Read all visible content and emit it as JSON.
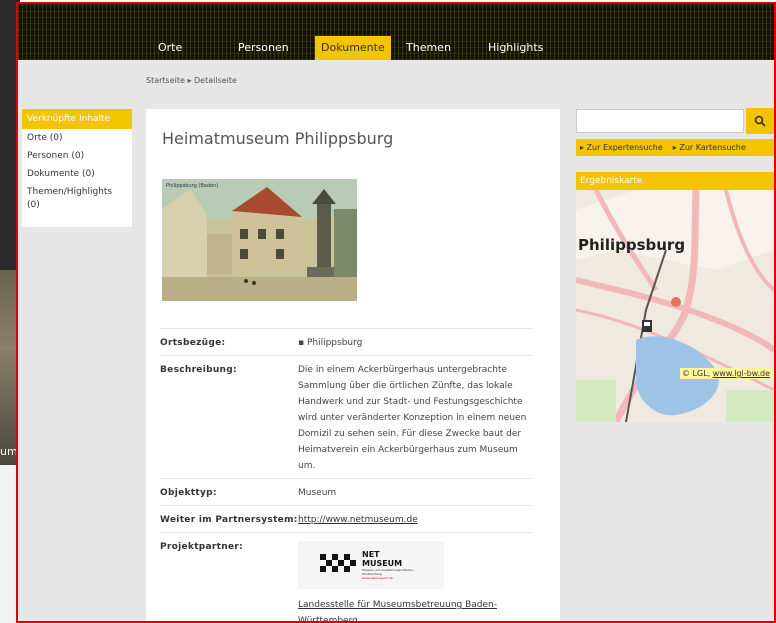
{
  "nav": {
    "items": [
      {
        "label": "Orte",
        "active": false
      },
      {
        "label": "Personen",
        "active": false
      },
      {
        "label": "Dokumente",
        "active": true
      },
      {
        "label": "Themen",
        "active": false
      },
      {
        "label": "Highlights",
        "active": false
      }
    ]
  },
  "breadcrumb": "Startseite ▸ Detailseite",
  "sidebar": {
    "title": "Verknüpfte Inhalte",
    "items": [
      "Orte (0)",
      "Personen (0)",
      "Dokumente (0)",
      "Themen/Highlights (0)"
    ]
  },
  "main": {
    "title": "Heimatmuseum Philippsburg",
    "photo_caption": "Philippsburg (Baden)",
    "details": [
      {
        "label": "Ortsbezüge:",
        "value": "▪ Philippsburg"
      },
      {
        "label": "Beschreibung:",
        "value": "Die in einem Ackerbürgerhaus untergebrachte Sammlung über die örtlichen Zünfte, das lokale Handwerk und zur Stadt- und Festungsgeschichte wird unter veränderter Konzeption in einem neuen Domizil zu sehen sein. Für diese Zwecke baut der Heimatverein ein Ackerbürgerhaus zum Museum um."
      },
      {
        "label": "Objekttyp:",
        "value": "Museum"
      },
      {
        "label": "Weiter im Partnersystem:",
        "value": "http://www.netmuseum.de"
      },
      {
        "label": "Projektpartner:",
        "value": "Landesstelle für Museumsbetreuung Baden-Württemberg"
      }
    ],
    "partner_logo": {
      "line1": "NET",
      "line2": "MUSEUM",
      "line3": "Museen und Ausstellungen Baden-Württemberg",
      "line4": "www.netmuseum.de"
    }
  },
  "right": {
    "search_placeholder": "",
    "search_icon": "search-icon",
    "links": [
      "▸ Zur Expertensuche",
      "▸ Zur Kartensuche"
    ],
    "map_title": "Ergebniskarte",
    "map_city": "Philippsburg",
    "map_copyright_prefix": "© LGL,",
    "map_copyright_link": "www.lgl-bw.de"
  },
  "background": {
    "label": "ume"
  },
  "colors": {
    "accent": "#f5c400",
    "frame": "#e00000"
  }
}
